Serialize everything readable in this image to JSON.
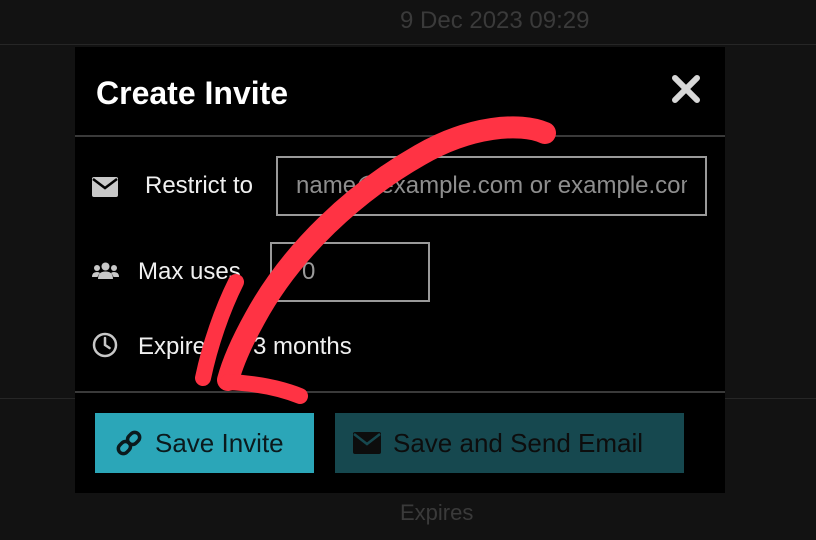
{
  "background": {
    "timestamp": "9 Dec 2023 09:29",
    "expires_header": "Expires"
  },
  "modal": {
    "title": "Create Invite",
    "close_icon": "close-icon",
    "fields": {
      "restrict_label": "Restrict to",
      "restrict_placeholder": "name@example.com or example.com",
      "max_uses_label": "Max uses",
      "max_uses_value": "0",
      "expires_label": "Expires",
      "expires_value": "3 months"
    },
    "buttons": {
      "save_label": "Save Invite",
      "send_label": "Save and Send Email"
    }
  },
  "colors": {
    "accent": "#2ba6b8",
    "accent_dark": "#16484f",
    "annotation_arrow": "#ff3344"
  }
}
